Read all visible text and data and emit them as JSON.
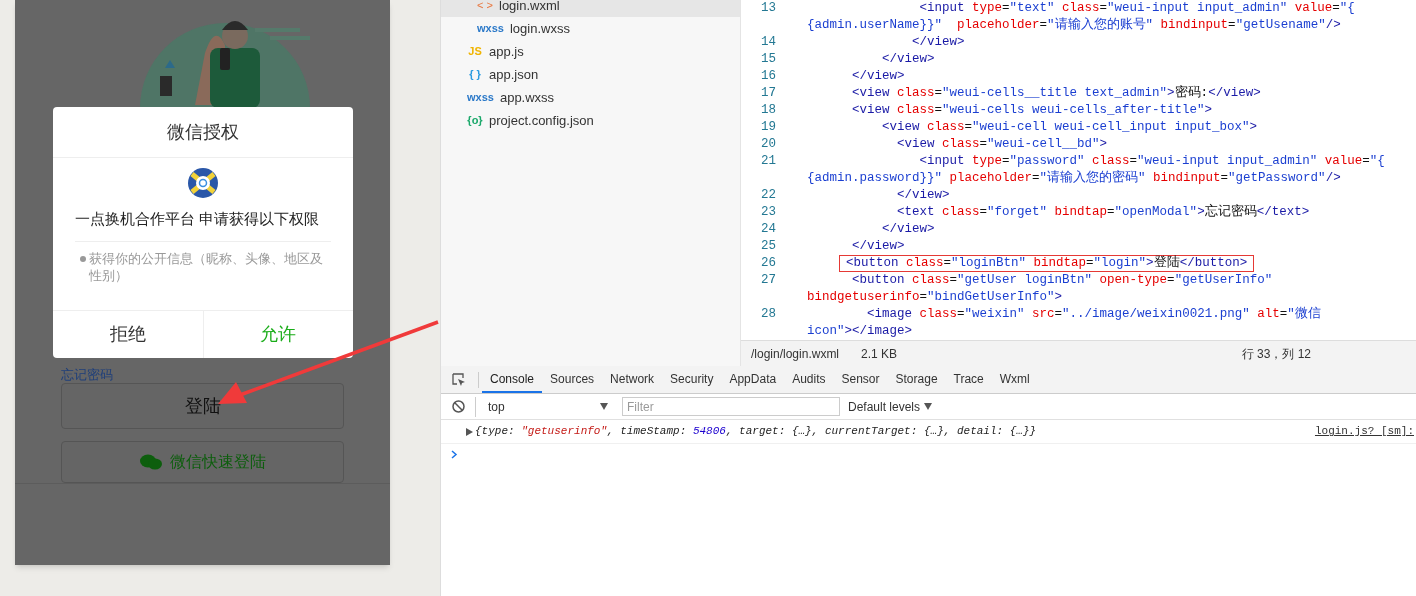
{
  "phone": {
    "forgot_link": "忘记密码",
    "login_button": "登陆",
    "wechat_button": "微信快速登陆"
  },
  "dialog": {
    "title": "微信授权",
    "request": "一点换机合作平台 申请获得以下权限",
    "permissions": [
      "获得你的公开信息（昵称、头像、地区及性别）"
    ],
    "buttons": [
      {
        "label": "拒绝",
        "kind": "cancel"
      },
      {
        "label": "允许",
        "kind": "confirm"
      }
    ]
  },
  "file_tree": [
    {
      "children": [
        {
          "name": "login.wxml",
          "icon": "< >",
          "kind": "wxml",
          "selected": true
        },
        {
          "name": "login.wxss",
          "icon": "wxss",
          "kind": "wxss",
          "selected": false
        }
      ]
    },
    {
      "name": "app.js",
      "icon": "JS",
      "kind": "js",
      "selected": false
    },
    {
      "name": "app.json",
      "icon": "{ }",
      "kind": "json",
      "selected": false
    },
    {
      "name": "app.wxss",
      "icon": "wxss",
      "kind": "wxss",
      "selected": false
    },
    {
      "name": "project.config.json",
      "icon": "{o}",
      "kind": "config",
      "selected": false
    }
  ],
  "editor": {
    "rows": [
      {
        "number": "13",
        "boxed": false,
        "code": [
          {
            "kind": "tag",
            "text": "               <input"
          },
          {
            "kind": "attr",
            "text": " type"
          },
          {
            "kind": "plain",
            "text": "="
          },
          {
            "kind": "value",
            "text": "\"text\""
          },
          {
            "kind": "attr",
            "text": " class"
          },
          {
            "kind": "plain",
            "text": "="
          },
          {
            "kind": "value",
            "text": "\"weui-input input_admin\""
          },
          {
            "kind": "attr",
            "text": " value"
          },
          {
            "kind": "plain",
            "text": "="
          },
          {
            "kind": "value",
            "text": "\"{"
          }
        ]
      },
      {
        "boxed": false,
        "code": [
          {
            "kind": "value",
            "text": "{admin.userName}}\""
          },
          {
            "kind": "attr",
            "text": "  placeholder"
          },
          {
            "kind": "plain",
            "text": "="
          },
          {
            "kind": "value",
            "text": "\"请输入您的账号\""
          },
          {
            "kind": "attr",
            "text": " bindinput"
          },
          {
            "kind": "plain",
            "text": "="
          },
          {
            "kind": "value",
            "text": "\"getUsename\""
          },
          {
            "kind": "tag",
            "text": "/>"
          }
        ]
      },
      {
        "number": "14",
        "boxed": false,
        "code": [
          {
            "kind": "tag",
            "text": "              </view>"
          }
        ]
      },
      {
        "number": "15",
        "boxed": false,
        "code": [
          {
            "kind": "tag",
            "text": "          </view>"
          }
        ]
      },
      {
        "number": "16",
        "boxed": false,
        "code": [
          {
            "kind": "tag",
            "text": "      </view>"
          }
        ]
      },
      {
        "number": "17",
        "boxed": false,
        "code": [
          {
            "kind": "tag",
            "text": "      <view"
          },
          {
            "kind": "attr",
            "text": " class"
          },
          {
            "kind": "plain",
            "text": "="
          },
          {
            "kind": "value",
            "text": "\"weui-cells__title text_admin\""
          },
          {
            "kind": "tag",
            "text": ">"
          },
          {
            "kind": "plain",
            "text": "密码:"
          },
          {
            "kind": "tag",
            "text": "</view>"
          }
        ]
      },
      {
        "number": "18",
        "boxed": false,
        "code": [
          {
            "kind": "tag",
            "text": "      <view"
          },
          {
            "kind": "attr",
            "text": " class"
          },
          {
            "kind": "plain",
            "text": "="
          },
          {
            "kind": "value",
            "text": "\"weui-cells weui-cells_after-title\""
          },
          {
            "kind": "tag",
            "text": ">"
          }
        ]
      },
      {
        "number": "19",
        "boxed": false,
        "code": [
          {
            "kind": "tag",
            "text": "          <view"
          },
          {
            "kind": "attr",
            "text": " class"
          },
          {
            "kind": "plain",
            "text": "="
          },
          {
            "kind": "value",
            "text": "\"weui-cell weui-cell_input input_box\""
          },
          {
            "kind": "tag",
            "text": ">"
          }
        ]
      },
      {
        "number": "20",
        "boxed": false,
        "code": [
          {
            "kind": "tag",
            "text": "            <view"
          },
          {
            "kind": "attr",
            "text": " class"
          },
          {
            "kind": "plain",
            "text": "="
          },
          {
            "kind": "value",
            "text": "\"weui-cell__bd\""
          },
          {
            "kind": "tag",
            "text": ">"
          }
        ]
      },
      {
        "number": "21",
        "boxed": false,
        "code": [
          {
            "kind": "tag",
            "text": "               <input"
          },
          {
            "kind": "attr",
            "text": " type"
          },
          {
            "kind": "plain",
            "text": "="
          },
          {
            "kind": "value",
            "text": "\"password\""
          },
          {
            "kind": "attr",
            "text": " class"
          },
          {
            "kind": "plain",
            "text": "="
          },
          {
            "kind": "value",
            "text": "\"weui-input input_admin\""
          },
          {
            "kind": "attr",
            "text": " value"
          },
          {
            "kind": "plain",
            "text": "="
          },
          {
            "kind": "value",
            "text": "\"{"
          }
        ]
      },
      {
        "boxed": false,
        "code": [
          {
            "kind": "value",
            "text": "{admin.password}}\""
          },
          {
            "kind": "attr",
            "text": " placeholder"
          },
          {
            "kind": "plain",
            "text": "="
          },
          {
            "kind": "value",
            "text": "\"请输入您的密码\""
          },
          {
            "kind": "attr",
            "text": " bindinput"
          },
          {
            "kind": "plain",
            "text": "="
          },
          {
            "kind": "value",
            "text": "\"getPassword\""
          },
          {
            "kind": "tag",
            "text": "/>"
          }
        ]
      },
      {
        "number": "22",
        "boxed": false,
        "code": [
          {
            "kind": "tag",
            "text": "            </view>"
          }
        ]
      },
      {
        "number": "23",
        "boxed": false,
        "code": [
          {
            "kind": "tag",
            "text": "            <text"
          },
          {
            "kind": "attr",
            "text": " class"
          },
          {
            "kind": "plain",
            "text": "="
          },
          {
            "kind": "value",
            "text": "\"forget\""
          },
          {
            "kind": "attr",
            "text": " bindtap"
          },
          {
            "kind": "plain",
            "text": "="
          },
          {
            "kind": "value",
            "text": "\"openModal\""
          },
          {
            "kind": "tag",
            "text": ">"
          },
          {
            "kind": "plain",
            "text": "忘记密码"
          },
          {
            "kind": "tag",
            "text": "</text>"
          }
        ]
      },
      {
        "number": "24",
        "boxed": false,
        "code": [
          {
            "kind": "tag",
            "text": "          </view>"
          }
        ]
      },
      {
        "number": "25",
        "boxed": false,
        "code": [
          {
            "kind": "tag",
            "text": "      </view>"
          }
        ]
      },
      {
        "number": "26",
        "boxed": true,
        "code": [
          {
            "kind": "tag",
            "text": "<button"
          },
          {
            "kind": "attr",
            "text": " class"
          },
          {
            "kind": "plain",
            "text": "="
          },
          {
            "kind": "value",
            "text": "\"loginBtn\""
          },
          {
            "kind": "attr",
            "text": " bindtap"
          },
          {
            "kind": "plain",
            "text": "="
          },
          {
            "kind": "value",
            "text": "\"login\""
          },
          {
            "kind": "tag",
            "text": ">"
          },
          {
            "kind": "plain",
            "text": "登陆"
          },
          {
            "kind": "tag",
            "text": "</button>"
          }
        ]
      },
      {
        "number": "27",
        "boxed": false,
        "code": [
          {
            "kind": "tag",
            "text": "      <button"
          },
          {
            "kind": "attr",
            "text": " class"
          },
          {
            "kind": "plain",
            "text": "="
          },
          {
            "kind": "value",
            "text": "\"getUser loginBtn\""
          },
          {
            "kind": "attr",
            "text": " open-type"
          },
          {
            "kind": "plain",
            "text": "="
          },
          {
            "kind": "value",
            "text": "\"getUserInfo\""
          }
        ]
      },
      {
        "boxed": false,
        "code": [
          {
            "kind": "attr",
            "text": "bindgetuserinfo"
          },
          {
            "kind": "plain",
            "text": "="
          },
          {
            "kind": "value",
            "text": "\"bindGetUserInfo\""
          },
          {
            "kind": "tag",
            "text": ">"
          }
        ]
      },
      {
        "number": "28",
        "boxed": false,
        "code": [
          {
            "kind": "tag",
            "text": "        <image"
          },
          {
            "kind": "attr",
            "text": " class"
          },
          {
            "kind": "plain",
            "text": "="
          },
          {
            "kind": "value",
            "text": "\"weixin\""
          },
          {
            "kind": "attr",
            "text": " src"
          },
          {
            "kind": "plain",
            "text": "="
          },
          {
            "kind": "value",
            "text": "\"../image/weixin0021.png\""
          },
          {
            "kind": "attr",
            "text": " alt"
          },
          {
            "kind": "plain",
            "text": "="
          },
          {
            "kind": "value",
            "text": "\"微信"
          }
        ]
      },
      {
        "boxed": false,
        "code": [
          {
            "kind": "value",
            "text": "icon\""
          },
          {
            "kind": "tag",
            "text": "></image>"
          }
        ]
      }
    ],
    "status_bar": {
      "path": "/login/login.wxml",
      "size": "2.1 KB",
      "position": "行 33，列 12"
    }
  },
  "devtools": {
    "tabs": [
      {
        "label": "Console",
        "selected": true
      },
      {
        "label": "Sources",
        "selected": false
      },
      {
        "label": "Network",
        "selected": false
      },
      {
        "label": "Security",
        "selected": false
      },
      {
        "label": "AppData",
        "selected": false
      },
      {
        "label": "Audits",
        "selected": false
      },
      {
        "label": "Sensor",
        "selected": false
      },
      {
        "label": "Storage",
        "selected": false
      },
      {
        "label": "Trace",
        "selected": false
      },
      {
        "label": "Wxml",
        "selected": false
      }
    ],
    "context": "top",
    "filter_placeholder": "Filter",
    "levels": "Default levels",
    "messages": [
      {
        "tokens": [
          {
            "kind": "plain",
            "text": "{type: "
          },
          {
            "kind": "string",
            "text": "\"getuserinfo\""
          },
          {
            "kind": "plain",
            "text": ", timeStamp: "
          },
          {
            "kind": "number",
            "text": "54806"
          },
          {
            "kind": "plain",
            "text": ", target: {…}, currentTarget: {…}, detail: {…}}"
          }
        ],
        "source": "login.js? [sm]:"
      }
    ]
  }
}
